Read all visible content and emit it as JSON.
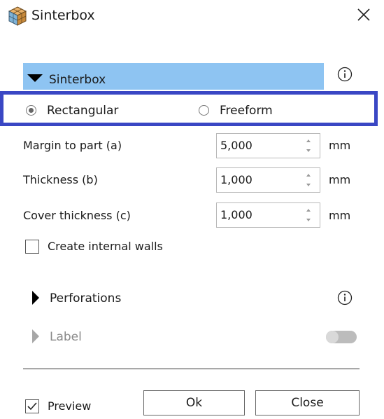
{
  "window": {
    "title": "Sinterbox",
    "app_icon": "sinterbox-cube-icon",
    "close_icon": "close-icon"
  },
  "section": {
    "label": "Sinterbox",
    "expanded": true,
    "info_icon": "info-icon"
  },
  "mode": {
    "options": [
      "Rectangular",
      "Freeform"
    ],
    "selected": "Rectangular"
  },
  "fields": [
    {
      "label": "Margin to part (a)",
      "value": "5,000",
      "unit": "mm"
    },
    {
      "label": "Thickness (b)",
      "value": "1,000",
      "unit": "mm"
    },
    {
      "label": "Cover thickness (c)",
      "value": "1,000",
      "unit": "mm"
    }
  ],
  "internal_walls": {
    "label": "Create internal walls",
    "checked": false
  },
  "perforations": {
    "label": "Perforations",
    "expanded": false,
    "info_icon": "info-icon"
  },
  "label_section": {
    "label": "Label",
    "enabled": false,
    "toggle_on": false
  },
  "footer": {
    "preview": {
      "label": "Preview",
      "checked": true
    },
    "ok_label": "Ok",
    "close_label": "Close"
  },
  "colors": {
    "section_header_bg": "#8ec4f2",
    "highlight_border": "#3a47c4"
  }
}
